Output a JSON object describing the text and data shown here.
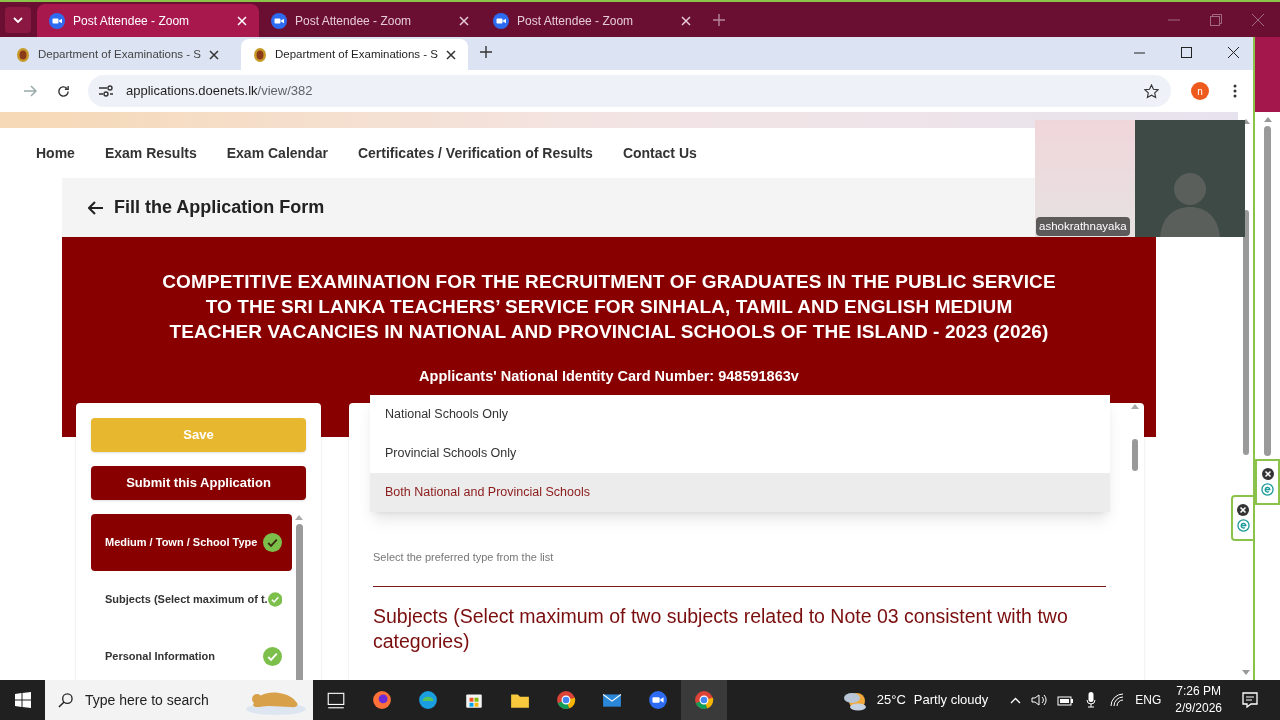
{
  "zoom_window": {
    "tabs": [
      {
        "label": "Post Attendee - Zoom",
        "selected": true
      },
      {
        "label": "Post Attendee - Zoom",
        "selected": false
      },
      {
        "label": "Post Attendee - Zoom",
        "selected": false
      }
    ]
  },
  "browser": {
    "tabs": [
      {
        "label": "Department of Examinations - S",
        "selected": false
      },
      {
        "label": "Department of Examinations - S",
        "selected": true
      }
    ],
    "url_host": "applications.doenets.lk",
    "url_path": "/view/382",
    "profile_letter": "n"
  },
  "nav": [
    "Home",
    "Exam Results",
    "Exam Calendar",
    "Certificates / Verification of Results",
    "Contact Us"
  ],
  "page_title": "Fill the Application Form",
  "banner": {
    "title_lines": [
      "COMPETITIVE EXAMINATION FOR THE RECRUITMENT OF GRADUATES IN THE PUBLIC SERVICE",
      "TO THE SRI LANKA TEACHERS’ SERVICE FOR SINHALA, TAMIL AND ENGLISH MEDIUM",
      "TEACHER VACANCIES IN NATIONAL AND PROVINCIAL SCHOOLS OF THE ISLAND - 2023 (2026)"
    ],
    "nic": "Applicants' National Identity Card Number: 948591863v"
  },
  "actions": [
    {
      "label": "Save",
      "kind": "save"
    },
    {
      "label": "Submit this Application",
      "kind": "submit"
    }
  ],
  "sections": [
    {
      "label": "Medium / Town / School Type",
      "selected": true,
      "complete": true
    },
    {
      "label": "Subjects (Select maximum of t.",
      "selected": false,
      "complete": true
    },
    {
      "label": "Personal Information",
      "selected": false,
      "complete": true
    }
  ],
  "dropdown": {
    "options": [
      {
        "label": "National Schools Only",
        "selected": false
      },
      {
        "label": "Provincial Schools Only",
        "selected": false
      },
      {
        "label": "Both National and Provincial Schools",
        "selected": true
      }
    ]
  },
  "hint": "Select the preferred type from the list",
  "subjects_heading": "Subjects (Select maximum of two subjects related to Note 03 consistent with two categories)",
  "video": {
    "name": "ashokrathnayaka"
  },
  "taskbar": {
    "search_placeholder": "Type here to search",
    "temperature": "25°C",
    "weather": "Partly cloudy",
    "language": "ENG",
    "time": "7:26 PM",
    "date": "2/9/2026"
  }
}
